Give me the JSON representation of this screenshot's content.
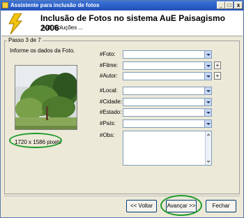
{
  "window": {
    "title": "Assistente para inclusão de fotos",
    "controls": [
      "_",
      "□",
      "x"
    ]
  },
  "header": {
    "title": "Inclusão de Fotos no sistema AuE Paisagismo 2006",
    "subtitle": "AuE Soluções ..."
  },
  "step": {
    "label": "Passo 3 de 7",
    "instruction": "Informe os dados da Foto."
  },
  "photo": {
    "dimensions": "1720 x 1586 pixels"
  },
  "fields": {
    "foto": "#Foto:",
    "filme": "#Filme:",
    "autor": "#Autor:",
    "local": "#Local:",
    "cidade": "#Cidade:",
    "estado": "#Estado:",
    "pais": "#País:",
    "obs": "#Obs:"
  },
  "buttons": {
    "back": "<< Voltar",
    "next": "Avançar >>",
    "close": "Fechar",
    "plus": "+"
  },
  "colors": {
    "titlebar": "#1e4fb8",
    "highlight": "#1d9a2a",
    "accent": "#f4d03f"
  }
}
